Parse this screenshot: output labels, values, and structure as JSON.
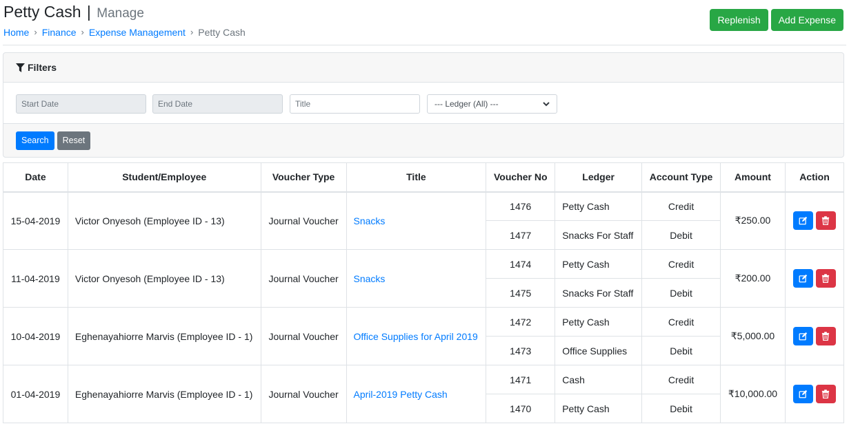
{
  "header": {
    "title": "Petty Cash",
    "separator": "|",
    "subtitle": "Manage",
    "breadcrumb": [
      {
        "label": "Home",
        "link": true
      },
      {
        "label": "Finance",
        "link": true
      },
      {
        "label": "Expense Management",
        "link": true
      },
      {
        "label": "Petty Cash",
        "link": false
      }
    ],
    "breadcrumb_separator": "›",
    "actions": {
      "replenish": "Replenish",
      "add_expense": "Add Expense"
    }
  },
  "filters": {
    "heading": "Filters",
    "start_date_placeholder": "Start Date",
    "end_date_placeholder": "End Date",
    "title_placeholder": "Title",
    "ledger_selected": "--- Ledger (All) ---",
    "search_label": "Search",
    "reset_label": "Reset"
  },
  "table": {
    "columns": [
      "Date",
      "Student/Employee",
      "Voucher Type",
      "Title",
      "Voucher No",
      "Ledger",
      "Account Type",
      "Amount",
      "Action"
    ],
    "rows": [
      {
        "date": "15-04-2019",
        "person": "Victor Onyesoh (Employee ID - 13)",
        "voucher_type": "Journal Voucher",
        "title": "Snacks",
        "amount": "₹250.00",
        "entries": [
          {
            "voucher_no": "1476",
            "ledger": "Petty Cash",
            "account_type": "Credit"
          },
          {
            "voucher_no": "1477",
            "ledger": "Snacks For Staff",
            "account_type": "Debit"
          }
        ]
      },
      {
        "date": "11-04-2019",
        "person": "Victor Onyesoh (Employee ID - 13)",
        "voucher_type": "Journal Voucher",
        "title": "Snacks",
        "amount": "₹200.00",
        "entries": [
          {
            "voucher_no": "1474",
            "ledger": "Petty Cash",
            "account_type": "Credit"
          },
          {
            "voucher_no": "1475",
            "ledger": "Snacks For Staff",
            "account_type": "Debit"
          }
        ]
      },
      {
        "date": "10-04-2019",
        "person": "Eghenayahiorre Marvis (Employee ID - 1)",
        "voucher_type": "Journal Voucher",
        "title": "Office Supplies for April 2019",
        "amount": "₹5,000.00",
        "entries": [
          {
            "voucher_no": "1472",
            "ledger": "Petty Cash",
            "account_type": "Credit"
          },
          {
            "voucher_no": "1473",
            "ledger": "Office Supplies",
            "account_type": "Debit"
          }
        ]
      },
      {
        "date": "01-04-2019",
        "person": "Eghenayahiorre Marvis (Employee ID - 1)",
        "voucher_type": "Journal Voucher",
        "title": "April-2019 Petty Cash",
        "amount": "₹10,000.00",
        "entries": [
          {
            "voucher_no": "1471",
            "ledger": "Cash",
            "account_type": "Credit"
          },
          {
            "voucher_no": "1470",
            "ledger": "Petty Cash",
            "account_type": "Debit"
          }
        ]
      }
    ]
  },
  "colors": {
    "primary": "#007bff",
    "success": "#28a745",
    "danger": "#dc3545",
    "secondary": "#6c757d"
  }
}
